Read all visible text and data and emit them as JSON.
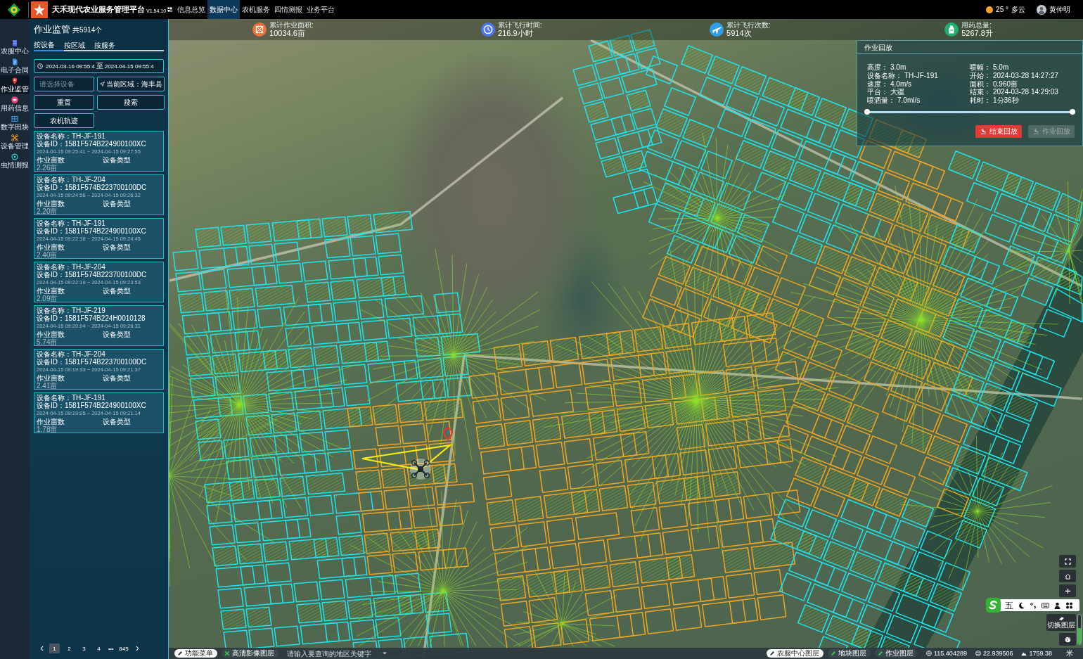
{
  "header": {
    "title": "天禾现代农业服务管理平台",
    "version": "V1.54.10",
    "nav": [
      {
        "label": "信息总览",
        "selected": false
      },
      {
        "label": "数据中心",
        "selected": true
      },
      {
        "label": "农机服务",
        "selected": false
      },
      {
        "label": "四情测报",
        "selected": false
      },
      {
        "label": "业务平台",
        "selected": false
      }
    ],
    "weather": {
      "temperature": "25 °",
      "condition": "多云"
    },
    "user": {
      "name": "黄仲明"
    }
  },
  "sidebar": {
    "items": [
      {
        "label": "农服中心",
        "selected": false
      },
      {
        "label": "电子合同",
        "selected": false
      },
      {
        "label": "作业监管",
        "selected": true
      },
      {
        "label": "用药信息",
        "selected": false
      },
      {
        "label": "数字田块",
        "selected": false
      },
      {
        "label": "设备管理",
        "selected": false
      },
      {
        "label": "虫情测报",
        "selected": false
      }
    ]
  },
  "panel": {
    "title": "作业监管",
    "count": "共5914个",
    "tabs": [
      {
        "label": "按设备",
        "selected": true
      },
      {
        "label": "按区域",
        "selected": false
      },
      {
        "label": "按服务",
        "selected": false
      }
    ],
    "date_range": {
      "start": "2024-03-16 09:55:4",
      "separator": "至",
      "end": "2024-04-15 09:55:4"
    },
    "device_select": {
      "placeholder": "请选择设备"
    },
    "region_button": {
      "label": "当前区域：海丰县"
    },
    "actions": [
      {
        "label": "重置"
      },
      {
        "label": "搜索"
      },
      {
        "label": "农机轨迹"
      }
    ],
    "records": [
      {
        "device_name": "设备名称：TH-JF-191",
        "device_id": "设备ID：1581F574B224900100XC",
        "time": "2024-04-15 09:25:41 ~ 2024-04-15 09:27:55",
        "area_label": "作业亩数",
        "type_label": "设备类型",
        "area": "2.26亩"
      },
      {
        "device_name": "设备名称：TH-JF-204",
        "device_id": "设备ID：1581F574B223700100DC",
        "time": "2024-04-15 09:24:56 ~ 2024-04-15 09:26:32",
        "area_label": "作业亩数",
        "type_label": "设备类型",
        "area": "2.20亩"
      },
      {
        "device_name": "设备名称：TH-JF-191",
        "device_id": "设备ID：1581F574B224900100XC",
        "time": "2024-04-15 09:22:38 ~ 2024-04-15 09:24:45",
        "area_label": "作业亩数",
        "type_label": "设备类型",
        "area": "2.40亩"
      },
      {
        "device_name": "设备名称：TH-JF-204",
        "device_id": "设备ID：1581F574B223700100DC",
        "time": "2024-04-15 09:22:19 ~ 2024-04-15 09:23:53",
        "area_label": "作业亩数",
        "type_label": "设备类型",
        "area": "2.09亩"
      },
      {
        "device_name": "设备名称：TH-JF-219",
        "device_id": "设备ID：1581F574B224H0010128",
        "time": "2024-04-15 09:20:04 ~ 2024-04-15 09:26:31",
        "area_label": "作业亩数",
        "type_label": "设备类型",
        "area": "5.74亩"
      },
      {
        "device_name": "设备名称：TH-JF-204",
        "device_id": "设备ID：1581F574B223700100DC",
        "time": "2024-04-15 09:19:33 ~ 2024-04-15 09:21:37",
        "area_label": "作业亩数",
        "type_label": "设备类型",
        "area": "2.41亩"
      },
      {
        "device_name": "设备名称：TH-JF-191",
        "device_id": "设备ID：1581F574B224900100XC",
        "time": "2024-04-15 09:19:05 ~ 2024-04-15 09:21:14",
        "area_label": "作业亩数",
        "type_label": "设备类型",
        "area": "1.78亩"
      }
    ],
    "pagination": {
      "pages": [
        {
          "label": "1",
          "selected": true
        },
        {
          "label": "2",
          "selected": false
        },
        {
          "label": "3",
          "selected": false
        },
        {
          "label": "4",
          "selected": false
        }
      ],
      "ellipsis": "•••",
      "last_page": {
        "label": "845",
        "selected": false
      }
    }
  },
  "map": {
    "stats": [
      {
        "label": "累计作业面积:",
        "value": "10034.6亩"
      },
      {
        "label": "累计飞行时间:",
        "value": "216.9小时"
      },
      {
        "label": "累计飞行次数:",
        "value": "5914次"
      },
      {
        "label": "用药总量:",
        "value": "5267.8升"
      }
    ],
    "playback": {
      "title": "作业回放",
      "left": [
        {
          "label": "高度：",
          "value": "3.0m"
        },
        {
          "label": "设备名称：",
          "value": "TH-JF-191"
        },
        {
          "label": "速度：",
          "value": "4.0m/s"
        },
        {
          "label": "平台：",
          "value": "大疆"
        },
        {
          "label": "喷洒量：",
          "value": "7.0ml/s"
        }
      ],
      "right": [
        {
          "label": "喷幅：",
          "value": "5.0m"
        },
        {
          "label": "开始：",
          "value": "2024-03-28 14:27:27"
        },
        {
          "label": "面积：",
          "value": "0.960亩"
        },
        {
          "label": "结束：",
          "value": "2024-03-28 14:29:03"
        },
        {
          "label": "耗时：",
          "value": "1分36秒"
        }
      ],
      "progress": {
        "level": 1
      },
      "buttons": [
        {
          "label": "结束回放",
          "disabled": false
        },
        {
          "label": "作业回放",
          "disabled": true
        }
      ]
    },
    "controls": {
      "layer_switch": {
        "label": "切换图层"
      },
      "zoom": {
        "level": 0.55
      }
    },
    "input_method_bar": {
      "mode": "五"
    },
    "bottom_bar": {
      "menu_button": {
        "label": "功能菜单"
      },
      "imagery_layer": {
        "label": "高清影像图层",
        "on": true
      },
      "search": {
        "placeholder": "请输入要查询的地区关键字"
      },
      "layers": [
        {
          "label": "农服中心图层",
          "on": false
        },
        {
          "label": "地块图层",
          "on": true
        },
        {
          "label": "作业图层",
          "on": true
        }
      ],
      "longitude": "115.404289",
      "latitude": "22.939506",
      "altitude": "1759.38",
      "unit": "米"
    }
  }
}
